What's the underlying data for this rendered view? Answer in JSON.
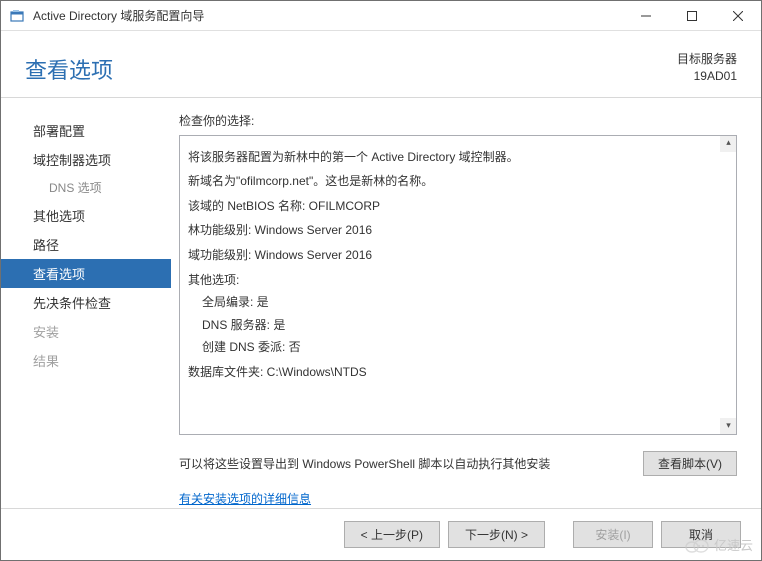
{
  "window": {
    "title": "Active Directory 域服务配置向导"
  },
  "header": {
    "heading": "查看选项",
    "target_label": "目标服务器",
    "target_value": "19AD01"
  },
  "sidebar": {
    "items": [
      {
        "label": "部署配置"
      },
      {
        "label": "域控制器选项"
      },
      {
        "label": "DNS 选项"
      },
      {
        "label": "其他选项"
      },
      {
        "label": "路径"
      },
      {
        "label": "查看选项"
      },
      {
        "label": "先决条件检查"
      },
      {
        "label": "安装"
      },
      {
        "label": "结果"
      }
    ]
  },
  "main": {
    "review_label": "检查你的选择:",
    "lines": [
      "将该服务器配置为新林中的第一个 Active Directory 域控制器。",
      "新域名为\"ofilmcorp.net\"。这也是新林的名称。",
      "该域的 NetBIOS 名称: OFILMCORP",
      "林功能级别: Windows Server 2016",
      "域功能级别: Windows Server 2016"
    ],
    "other_options_label": "其他选项:",
    "other_options": [
      "全局编录: 是",
      "DNS 服务器: 是",
      "创建 DNS 委派: 否"
    ],
    "db_path": "数据库文件夹: C:\\Windows\\NTDS",
    "export_text": "可以将这些设置导出到 Windows PowerShell 脚本以自动执行其他安装",
    "view_script_btn": "查看脚本(V)",
    "more_link": "有关安装选项的详细信息"
  },
  "footer": {
    "prev": "< 上一步(P)",
    "next": "下一步(N) >",
    "install": "安装(I)",
    "cancel": "取消"
  },
  "watermark": "亿速云"
}
